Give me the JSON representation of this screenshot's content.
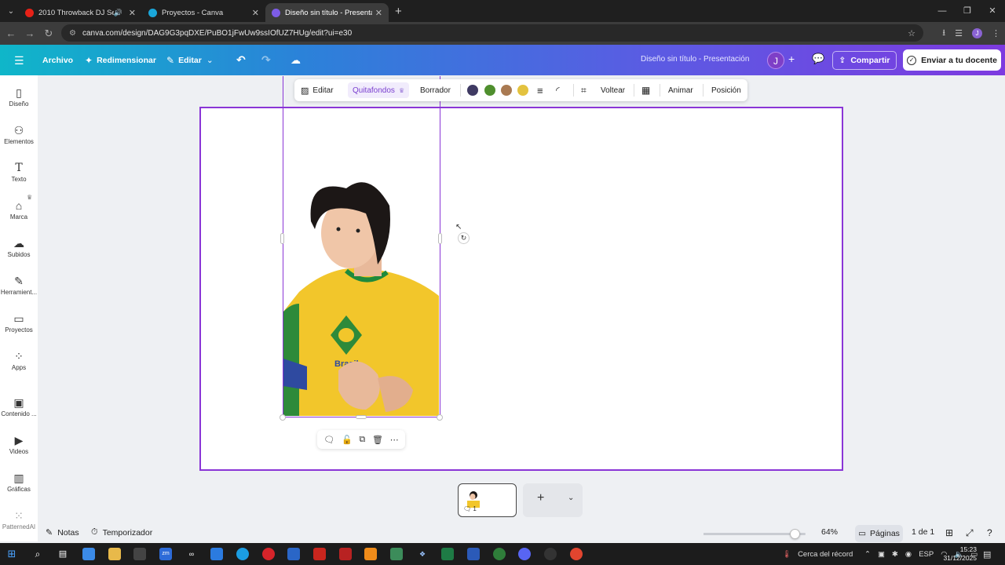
{
  "browser": {
    "tabs": [
      {
        "title": "2010 Throwback DJ Set (Ri…",
        "favicon_color": "#e62117",
        "has_audio": true,
        "active": false
      },
      {
        "title": "Proyectos - Canva",
        "favicon_color": "#1aa6d9",
        "has_audio": false,
        "active": false
      },
      {
        "title": "Diseño sin título - Presentación",
        "favicon_color": "#7d5ce6",
        "has_audio": false,
        "active": true
      }
    ],
    "url": "canva.com/design/DAG9G3pqDXE/PuBO1jFwUw9ssIOfUZ7HUg/edit?ui=e30",
    "profile_initial": "J"
  },
  "canva_header": {
    "file_label": "Archivo",
    "resize_label": "Redimensionar",
    "edit_label": "Editar",
    "doc_title": "Diseño sin título - Presentación",
    "avatar_initial": "J",
    "share_label": "Compartir",
    "send_label": "Enviar a tu docente"
  },
  "sidebar": {
    "items": [
      {
        "label": "Diseño",
        "icon": "layout-icon"
      },
      {
        "label": "Elementos",
        "icon": "shapes-icon"
      },
      {
        "label": "Texto",
        "icon": "text-icon"
      },
      {
        "label": "Marca",
        "icon": "brand-icon"
      },
      {
        "label": "Subidos",
        "icon": "cloud-upload-icon"
      },
      {
        "label": "Herramient...",
        "icon": "pen-icon"
      },
      {
        "label": "Proyectos",
        "icon": "folder-icon"
      },
      {
        "label": "Apps",
        "icon": "apps-icon"
      },
      {
        "label": "Contenido ...",
        "icon": "image-icon"
      },
      {
        "label": "Videos",
        "icon": "video-icon"
      },
      {
        "label": "Gráficas",
        "icon": "chart-icon"
      },
      {
        "label": "PatternedAI",
        "icon": "pattern-icon"
      }
    ]
  },
  "context_toolbar": {
    "edit": "Editar",
    "bg_remover": "Quitafondos",
    "eraser": "Borrador",
    "colors": [
      "#3f3a63",
      "#4f8f2e",
      "#a97a52",
      "#e3c23f"
    ],
    "flip": "Voltear",
    "animate": "Animar",
    "position": "Posición"
  },
  "footer": {
    "notes": "Notas",
    "timer": "Temporizador",
    "zoom": "64%",
    "zoom_fraction": 0.48,
    "pages": "Páginas",
    "page_count": "1 de 1",
    "thumb_page_number": "1"
  },
  "taskbar": {
    "weather": "Cerca del récord",
    "lang": "ESP",
    "time": "15:23",
    "date": "31/12/2025"
  }
}
